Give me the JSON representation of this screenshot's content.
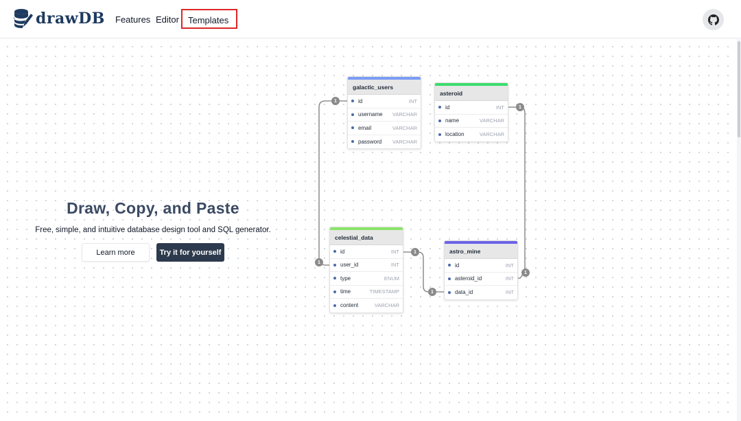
{
  "nav": {
    "brand": "drawDB",
    "links": [
      "Features",
      "Editor",
      "Templates"
    ]
  },
  "hero": {
    "title": "Draw, Copy, and Paste",
    "subtitle": "Free, simple, and intuitive database design tool and SQL generator.",
    "learn_more": "Learn more",
    "try_it": "Try it for yourself"
  },
  "tables": {
    "galactic_users": {
      "name": "galactic_users",
      "color": "#7b9cf5",
      "fields": [
        {
          "name": "id",
          "type": "INT"
        },
        {
          "name": "username",
          "type": "VARCHAR"
        },
        {
          "name": "email",
          "type": "VARCHAR"
        },
        {
          "name": "password",
          "type": "VARCHAR"
        }
      ]
    },
    "asteroid": {
      "name": "asteroid",
      "color": "#3ddc6e",
      "fields": [
        {
          "name": "id",
          "type": "INT"
        },
        {
          "name": "name",
          "type": "VARCHAR"
        },
        {
          "name": "location",
          "type": "VARCHAR"
        }
      ]
    },
    "celestial_data": {
      "name": "celestial_data",
      "color": "#8be56b",
      "fields": [
        {
          "name": "id",
          "type": "INT"
        },
        {
          "name": "user_id",
          "type": "INT"
        },
        {
          "name": "type",
          "type": "ENUM"
        },
        {
          "name": "time",
          "type": "TIMESTAMP"
        },
        {
          "name": "content",
          "type": "VARCHAR"
        }
      ]
    },
    "astro_mine": {
      "name": "astro_mine",
      "color": "#6b63e8",
      "fields": [
        {
          "name": "id",
          "type": "INT"
        },
        {
          "name": "asteroid_id",
          "type": "INT"
        },
        {
          "name": "data_id",
          "type": "INT"
        }
      ]
    }
  },
  "relation_badge": "1",
  "colors": {
    "brand": "#1e3a5f",
    "primary_button": "#2d3a4d",
    "highlight": "#dc2626"
  }
}
